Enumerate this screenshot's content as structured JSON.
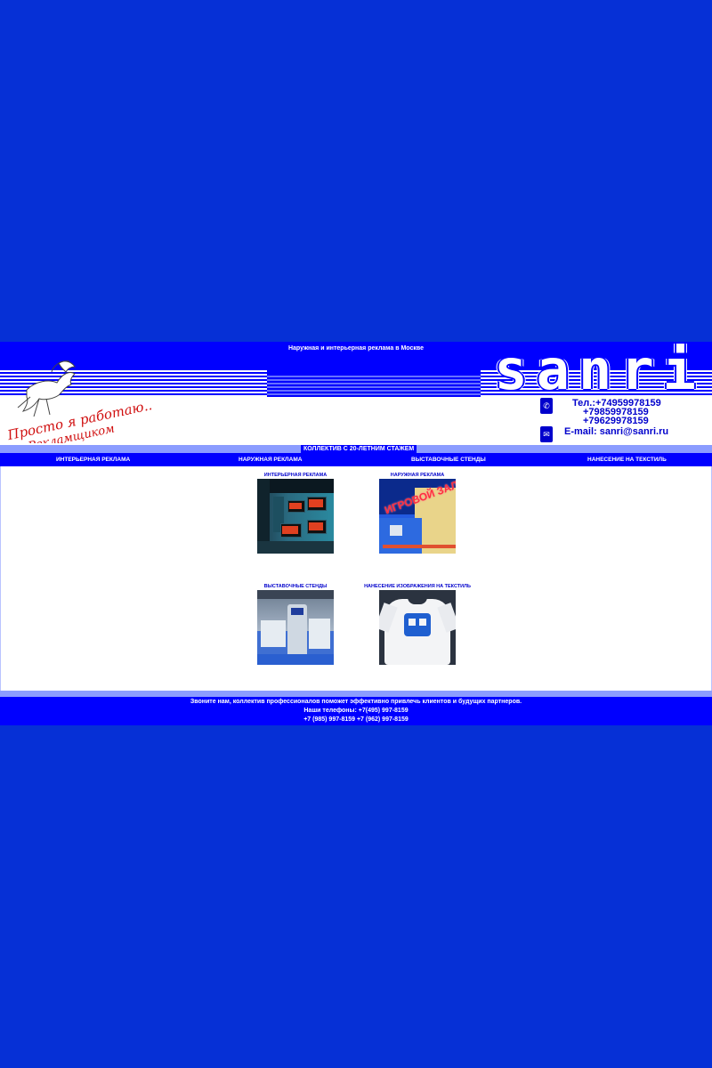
{
  "header": {
    "title": "Наружная и интерьерная реклама в Москве",
    "logo_text_line1": "Просто я работаю...",
    "logo_text_line2": "Рекламщиком",
    "brand": "sanri"
  },
  "contacts": {
    "tel1": "Тел.:+74959978159",
    "tel2": "+79859978159",
    "tel3": "+79629978159",
    "email": "E-mail: sanri@sanri.ru",
    "phone_icon": "phone-icon",
    "mail_icon": "mail-icon"
  },
  "tagline": "КОЛЛЕКТИВ С 20-ЛЕТНИМ СТАЖЕМ",
  "nav": {
    "items": [
      {
        "label": "ИНТЕРЬЕРНАЯ РЕКЛАМА"
      },
      {
        "label": "НАРУЖНАЯ РЕКЛАМА"
      },
      {
        "label": "ВЫСТАВОЧНЫЕ СТЕНДЫ"
      },
      {
        "label": "НАНЕСЕНИЕ НА ТЕКСТИЛЬ"
      }
    ]
  },
  "cards": [
    {
      "caption": "ИНТЕРЬЕРНАЯ РЕКЛАМА"
    },
    {
      "caption": "НАРУЖНАЯ РЕКЛАМА",
      "sign_text": "ИГРОВОЙ ЗАЛ"
    },
    {
      "caption": "ВЫСТАВОЧНЫЕ СТЕНДЫ"
    },
    {
      "caption": "НАНЕСЕНИЕ ИЗОБРАЖЕНИЯ НА ТЕКСТИЛЬ"
    }
  ],
  "footer": {
    "line1": "Звоните нам, коллектив профессионалов поможет эффективно привлечь клиентов и будущих партнеров.",
    "line2": "Наши телефоны: +7(495) 997-8159",
    "line3": "+7 (985) 997-8159 +7 (962) 997-8159"
  },
  "colors": {
    "page_background": "#0630d6",
    "brand_blue": "#0000ff",
    "light_stripe": "#8b9cff",
    "logo_red": "#d01010"
  }
}
